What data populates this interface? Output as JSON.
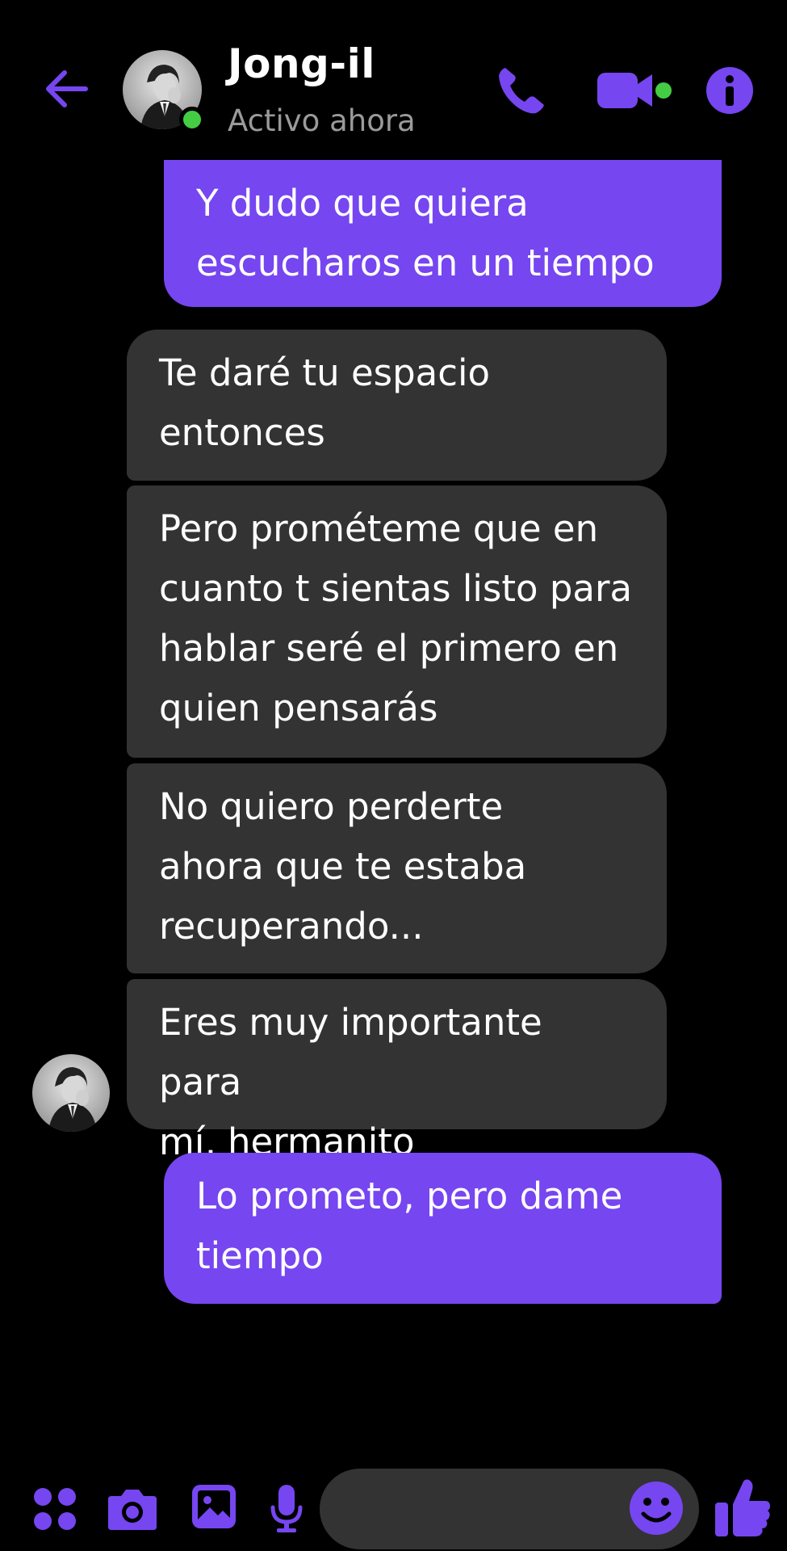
{
  "header": {
    "contact_name": "Jong-il",
    "status": "Activo ahora",
    "icons": [
      "back-arrow-icon",
      "phone-icon",
      "video-camera-icon",
      "info-icon"
    ]
  },
  "messages": [
    {
      "direction": "outgoing",
      "text": "Y dudo que quiera\nescucharos en un tiempo"
    },
    {
      "direction": "incoming",
      "text": "Te daré tu espacio\nentonces"
    },
    {
      "direction": "incoming",
      "text": "Pero prométeme que en\ncuanto t sientas listo para\nhablar seré el primero en\nquien pensarás"
    },
    {
      "direction": "incoming",
      "text": "No quiero perderte\nahora que te estaba\nrecuperando..."
    },
    {
      "direction": "incoming",
      "text": "Eres muy importante para\nmí, hermanito"
    },
    {
      "direction": "outgoing",
      "text": "Lo prometo, pero dame\ntiempo"
    }
  ],
  "composer": {
    "placeholder": "",
    "icons": [
      "apps-icon",
      "camera-icon",
      "image-icon",
      "microphone-icon",
      "emoji-icon",
      "thumbs-up-icon"
    ]
  },
  "colors": {
    "background": "#000000",
    "accent": "#7646f0",
    "incoming_bubble": "#333333",
    "online": "#44cc44",
    "status_text": "#9a9a9a"
  }
}
